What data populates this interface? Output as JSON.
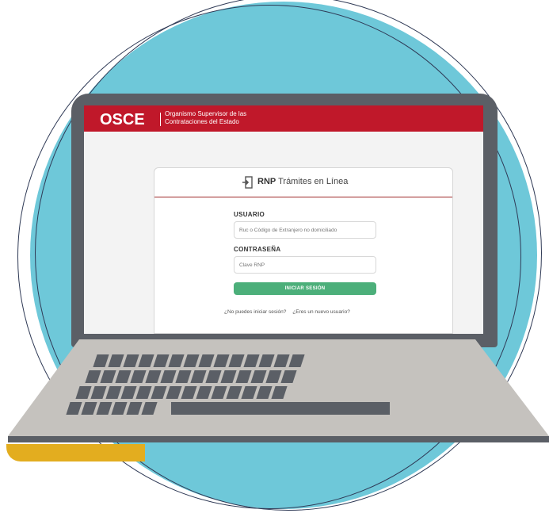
{
  "header": {
    "logo": "OSCE",
    "org_line1": "Organismo Supervisor de las",
    "org_line2": "Contrataciones del Estado"
  },
  "card": {
    "title_bold": "RNP",
    "title_rest": "Trámites en Línea",
    "usuario_label": "USUARIO",
    "usuario_placeholder": "Ruc o Código de Extranjero no domiciliado",
    "password_label": "CONTRASEÑA",
    "password_placeholder": "Clave RNP",
    "login_button": "INICIAR SESIÓN",
    "forgot_link": "¿No puedes iniciar sesión?",
    "new_user_link": "¿Eres un nuevo usuario?"
  },
  "colors": {
    "header_red": "#c0182a",
    "button_green": "#4caf7a",
    "circle_blue": "#6ec8d9",
    "laptop_gray": "#5b5f66",
    "accent_gold": "#e3ad1f"
  }
}
